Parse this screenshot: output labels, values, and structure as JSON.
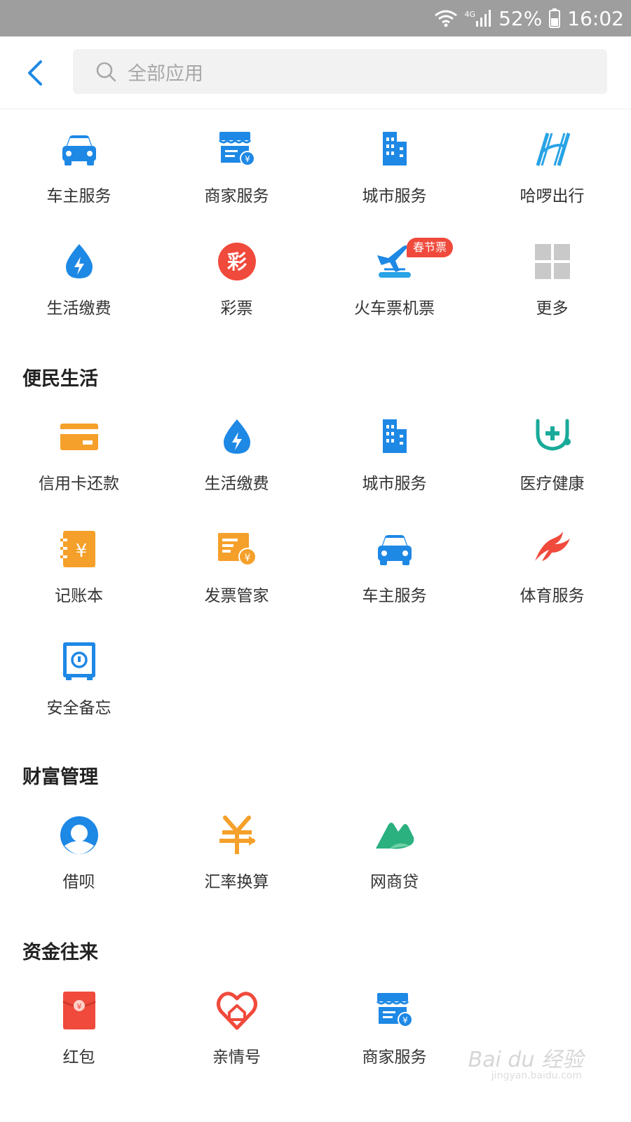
{
  "status_bar": {
    "network": "4G",
    "battery": "52%",
    "time": "16:02"
  },
  "search": {
    "placeholder": "全部应用"
  },
  "top_apps": [
    {
      "label": "车主服务",
      "icon": "car-icon"
    },
    {
      "label": "商家服务",
      "icon": "store-icon"
    },
    {
      "label": "城市服务",
      "icon": "city-icon"
    },
    {
      "label": "哈啰出行",
      "icon": "hello-icon"
    },
    {
      "label": "生活缴费",
      "icon": "utility-drop-icon"
    },
    {
      "label": "彩票",
      "icon": "lottery-icon"
    },
    {
      "label": "火车票机票",
      "icon": "train-plane-icon",
      "badge": "春节票"
    },
    {
      "label": "更多",
      "icon": "more-grid-icon"
    }
  ],
  "sections": [
    {
      "title": "便民生活",
      "items": [
        {
          "label": "信用卡还款",
          "icon": "credit-card-icon"
        },
        {
          "label": "生活缴费",
          "icon": "utility-drop-icon"
        },
        {
          "label": "城市服务",
          "icon": "city-icon"
        },
        {
          "label": "医疗健康",
          "icon": "stethoscope-icon"
        },
        {
          "label": "记账本",
          "icon": "ledger-icon"
        },
        {
          "label": "发票管家",
          "icon": "invoice-icon"
        },
        {
          "label": "车主服务",
          "icon": "car-icon"
        },
        {
          "label": "体育服务",
          "icon": "sports-icon"
        },
        {
          "label": "安全备忘",
          "icon": "safe-icon"
        }
      ]
    },
    {
      "title": "财富管理",
      "items": [
        {
          "label": "借呗",
          "icon": "jiebei-icon"
        },
        {
          "label": "汇率换算",
          "icon": "exchange-icon"
        },
        {
          "label": "网商贷",
          "icon": "mybank-loan-icon"
        }
      ]
    },
    {
      "title": "资金往来",
      "items": [
        {
          "label": "红包",
          "icon": "red-envelope-icon"
        },
        {
          "label": "亲情号",
          "icon": "family-heart-icon"
        },
        {
          "label": "商家服务",
          "icon": "store-icon"
        }
      ]
    }
  ],
  "watermark": {
    "text": "Bai du 经验",
    "url": "jingyan.baidu.com"
  },
  "colors": {
    "blue": "#1e88e5",
    "orange": "#f5a02a",
    "red": "#f04a3c",
    "green": "#2bb07f",
    "teal": "#1aaa9a"
  }
}
